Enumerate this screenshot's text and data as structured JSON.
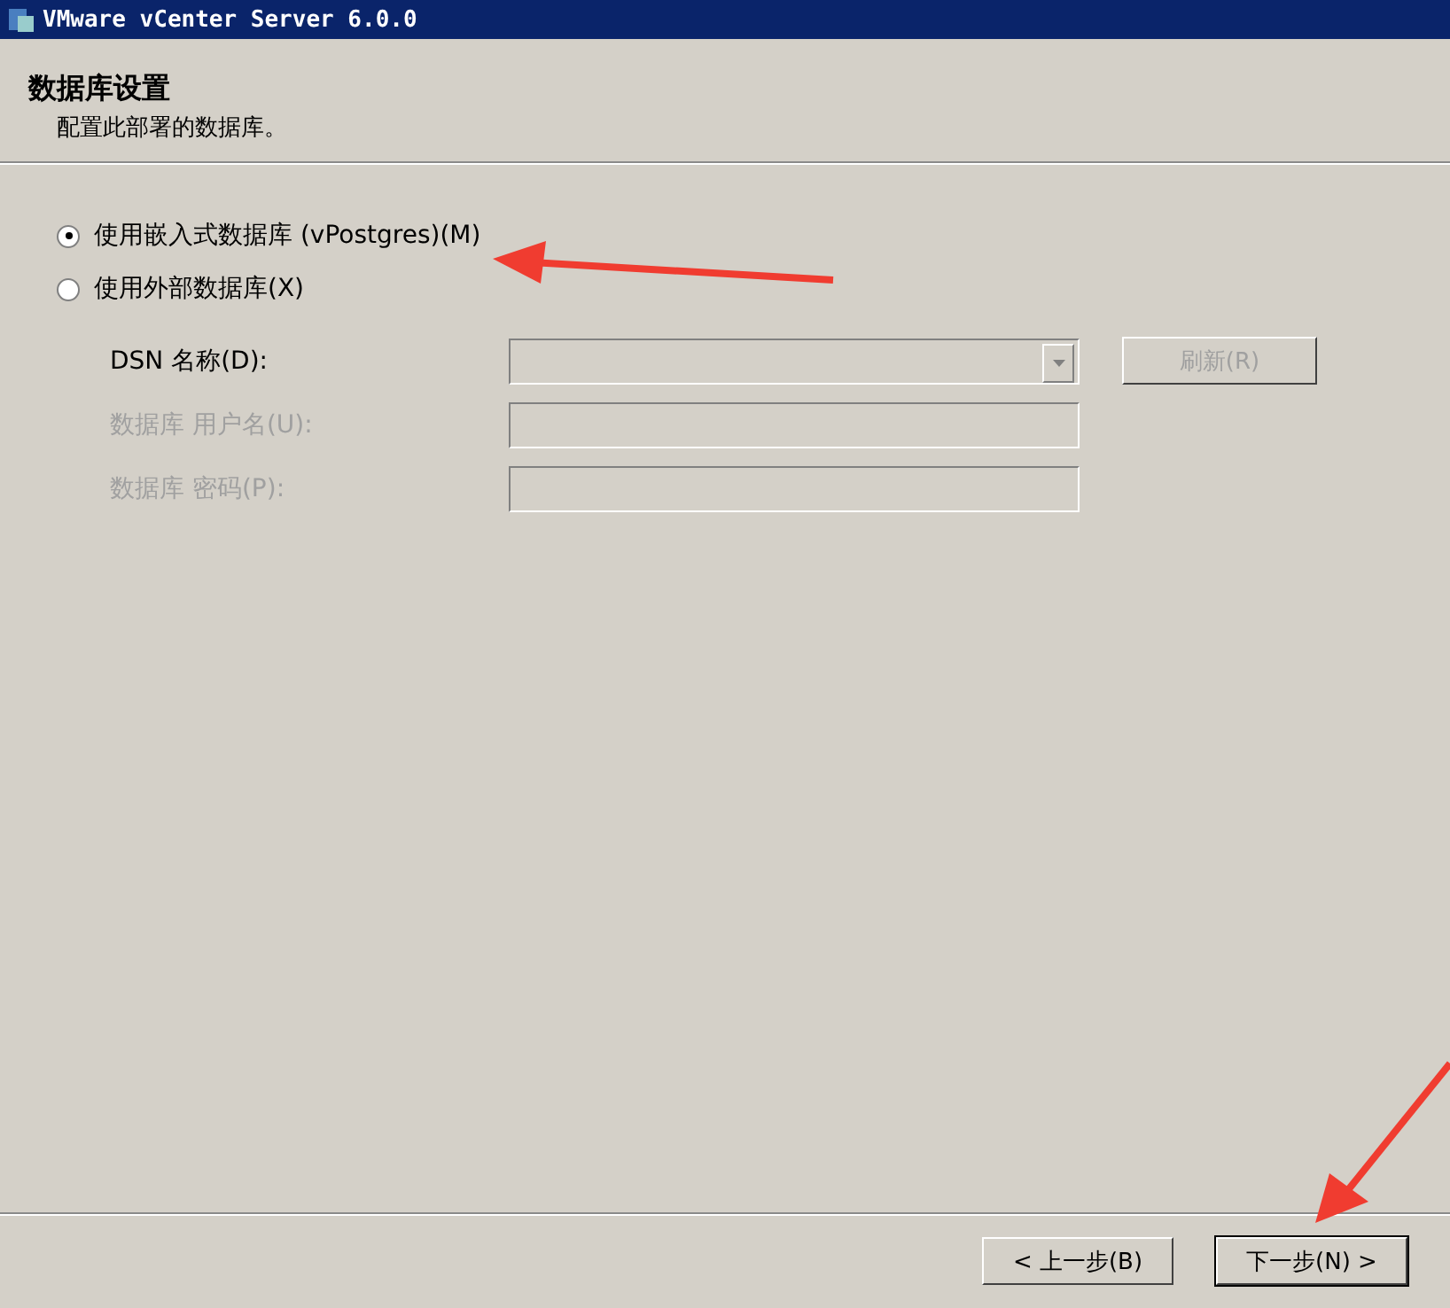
{
  "window": {
    "title": "VMware vCenter Server 6.0.0"
  },
  "header": {
    "title": "数据库设置",
    "subtitle": "配置此部署的数据库。"
  },
  "options": [
    {
      "label": "使用嵌入式数据库 (vPostgres)(M)",
      "selected": true
    },
    {
      "label": "使用外部数据库(X)",
      "selected": false
    }
  ],
  "fields": [
    {
      "kind": "dropdown",
      "label": "DSN 名称(D):",
      "disabled": false
    },
    {
      "kind": "text",
      "label": "数据库 用户名(U):",
      "disabled": true
    },
    {
      "kind": "text",
      "label": "数据库 密码(P):",
      "disabled": true
    }
  ],
  "refresh_button": {
    "label": "刷新(R)",
    "disabled": true
  },
  "buttons": [
    {
      "label": "< 上一步(B)",
      "default": false
    },
    {
      "label": "下一步(N) >",
      "default": true
    }
  ]
}
